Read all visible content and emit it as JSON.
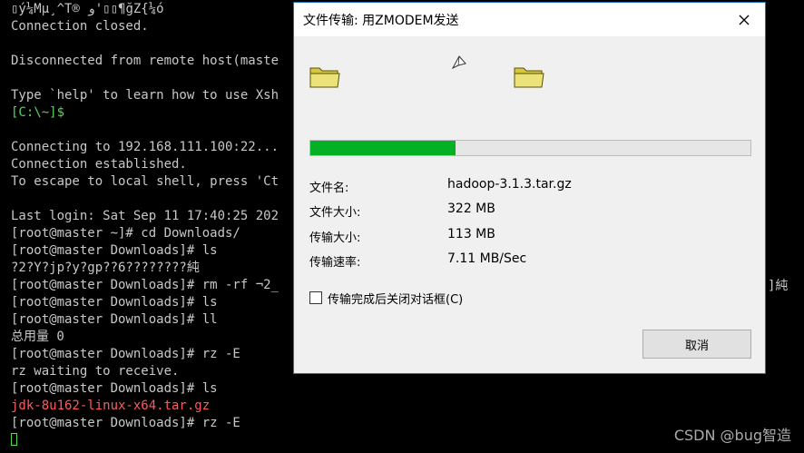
{
  "terminal": {
    "lines": [
      {
        "text": "▯ý¼Mµ¸^T® و'▯▯¶ğZ{¼ó",
        "style": ""
      },
      {
        "text": "Connection closed.",
        "style": ""
      },
      {
        "text": "",
        "style": ""
      },
      {
        "text": "Disconnected from remote host(maste",
        "style": ""
      },
      {
        "text": "",
        "style": ""
      },
      {
        "text": "Type `help' to learn how to use Xsh",
        "style": ""
      },
      {
        "text": "[C:\\~]$",
        "style": "green"
      },
      {
        "text": "",
        "style": ""
      },
      {
        "text": "Connecting to 192.168.111.100:22...",
        "style": ""
      },
      {
        "text": "Connection established.",
        "style": ""
      },
      {
        "text": "To escape to local shell, press 'Ct",
        "style": ""
      },
      {
        "text": "",
        "style": ""
      },
      {
        "text": "Last login: Sat Sep 11 17:40:25 202",
        "style": ""
      },
      {
        "text": "[root@master ~]# cd Downloads/",
        "style": ""
      },
      {
        "text": "[root@master Downloads]# ls",
        "style": ""
      },
      {
        "text": "?2?Y?jp?y?gp??6????????純",
        "style": ""
      },
      {
        "text": "[root@master Downloads]# rm -rf ¬2_",
        "style": ""
      },
      {
        "text": "[root@master Downloads]# ls",
        "style": ""
      },
      {
        "text": "[root@master Downloads]# ll",
        "style": ""
      },
      {
        "text": "总用量 0",
        "style": ""
      },
      {
        "text": "[root@master Downloads]# rz -E",
        "style": ""
      },
      {
        "text": "rz waiting to receive.",
        "style": ""
      },
      {
        "text": "[root@master Downloads]# ls",
        "style": ""
      },
      {
        "text": "jdk-8u162-linux-x64.tar.gz",
        "style": "red"
      },
      {
        "text": "[root@master Downloads]# rz -E",
        "style": ""
      }
    ],
    "behind_dialog_text": "]純"
  },
  "watermark": "CSDN @bug智造",
  "dialog": {
    "title": "文件传输: 用ZMODEM发送",
    "progress_percent": 33,
    "fields": [
      {
        "label": "文件名:",
        "value": "hadoop-3.1.3.tar.gz"
      },
      {
        "label": "文件大小:",
        "value": "322 MB"
      },
      {
        "label": "传输大小:",
        "value": "113 MB"
      },
      {
        "label": "传输速率:",
        "value": "7.11 MB/Sec"
      }
    ],
    "checkbox_label": "传输完成后关闭对话框(C)",
    "checkbox_checked": false,
    "cancel_label": "取消",
    "colors": {
      "progress": "#06b025",
      "border": "#1a6fbf"
    }
  }
}
